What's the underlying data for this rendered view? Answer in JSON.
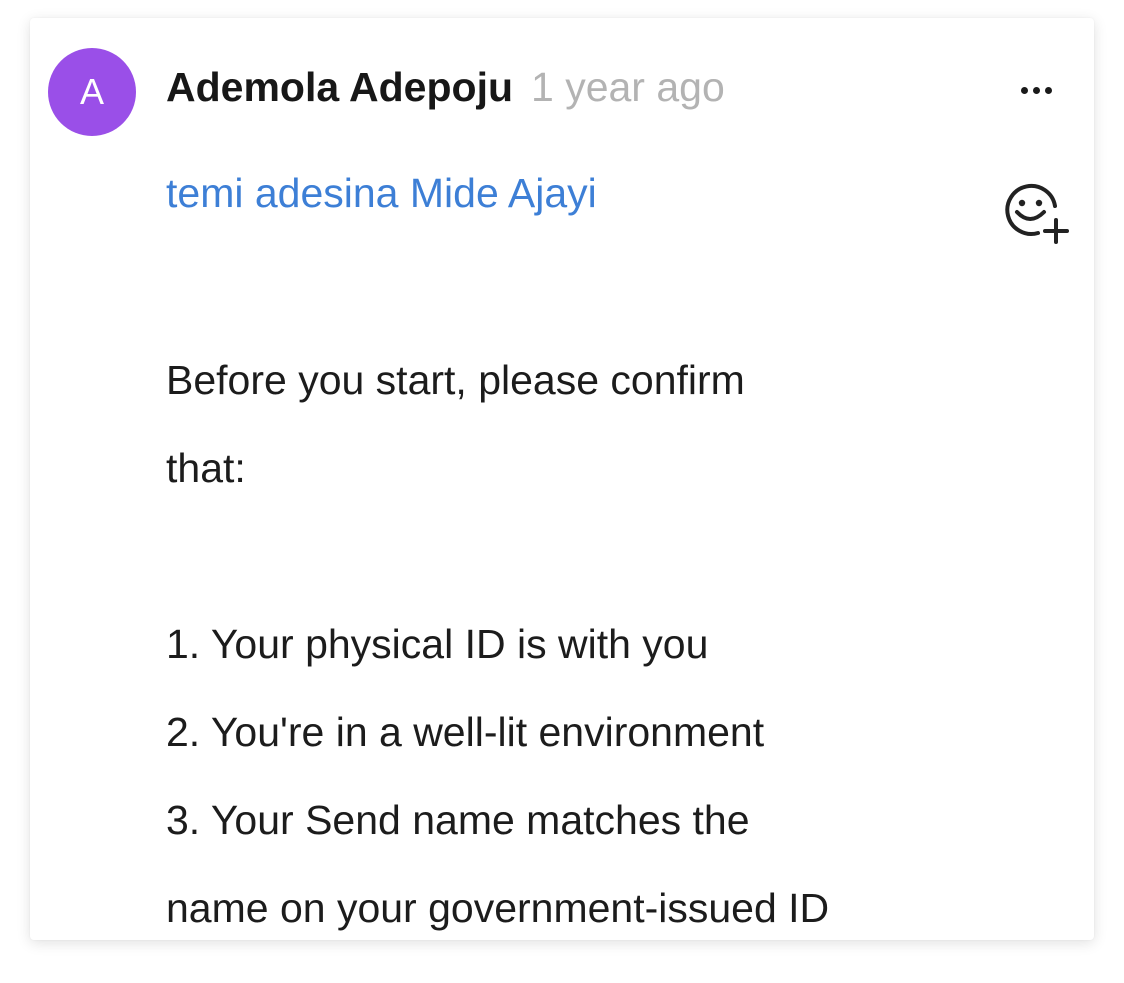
{
  "comment": {
    "avatar_initial": "A",
    "avatar_color": "#9a4fe8",
    "author": "Ademola Adepoju",
    "timestamp": "1 year ago",
    "mentions": [
      "temi adesina",
      "Mide Ajayi"
    ],
    "mention_color": "#3d7fd6",
    "body": {
      "intro_line1": "Before you start, please confirm",
      "intro_line2": "that:",
      "items": [
        "1. Your physical ID is with you",
        "2. You're in a well-lit environment",
        "3. Your Send name matches the",
        "name on your government-issued ID"
      ]
    },
    "icons": {
      "more": "more-options-icon",
      "reaction": "add-reaction-icon"
    }
  }
}
